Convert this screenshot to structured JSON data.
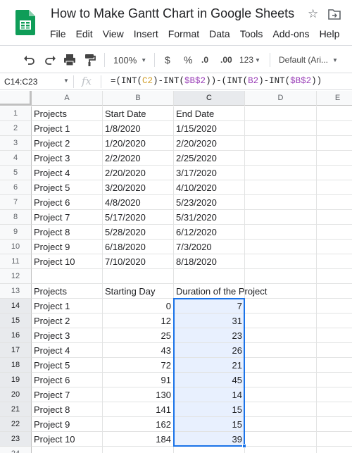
{
  "doc": {
    "title": "How to Make Gantt Chart in Google Sheets",
    "icons": {
      "logo": "google-sheets-logo",
      "star": "star-icon",
      "move": "move-to-folder-icon"
    }
  },
  "menu": [
    "File",
    "Edit",
    "View",
    "Insert",
    "Format",
    "Data",
    "Tools",
    "Add-ons",
    "Help"
  ],
  "toolbar": {
    "zoom": "100%",
    "currency": "$",
    "percent": "%",
    "decrease_decimals": ".0",
    "increase_decimals": ".00",
    "more_formats": "123",
    "font": "Default (Ari...",
    "icons": [
      "undo-icon",
      "redo-icon",
      "print-icon",
      "paint-format-icon"
    ]
  },
  "formula_bar": {
    "name_box": "C14:C23",
    "fx": "fx",
    "formula": {
      "p1": "=(INT(",
      "r1": "C2",
      "p2": ")-INT(",
      "r2": "$B$2",
      "p3": "))-(INT(",
      "r3": "B2",
      "p4": ")-INT(",
      "r4": "$B$2",
      "p5": "))"
    }
  },
  "grid": {
    "columns": [
      "A",
      "B",
      "C",
      "D",
      "E"
    ],
    "rows": [
      {
        "n": "1",
        "a": "Projects",
        "b": "Start Date",
        "c": "End Date"
      },
      {
        "n": "2",
        "a": "Project 1",
        "b": "1/8/2020",
        "c": "1/15/2020"
      },
      {
        "n": "3",
        "a": "Project 2",
        "b": "1/20/2020",
        "c": "2/20/2020"
      },
      {
        "n": "4",
        "a": "Project 3",
        "b": "2/2/2020",
        "c": "2/25/2020"
      },
      {
        "n": "5",
        "a": "Project 4",
        "b": "2/20/2020",
        "c": "3/17/2020"
      },
      {
        "n": "6",
        "a": "Project 5",
        "b": "3/20/2020",
        "c": "4/10/2020"
      },
      {
        "n": "7",
        "a": "Project 6",
        "b": "4/8/2020",
        "c": "5/23/2020"
      },
      {
        "n": "8",
        "a": "Project 7",
        "b": "5/17/2020",
        "c": "5/31/2020"
      },
      {
        "n": "9",
        "a": "Project 8",
        "b": "5/28/2020",
        "c": "6/12/2020"
      },
      {
        "n": "10",
        "a": "Project 9",
        "b": "6/18/2020",
        "c": "7/3/2020"
      },
      {
        "n": "11",
        "a": "Project 10",
        "b": "7/10/2020",
        "c": "8/18/2020"
      },
      {
        "n": "12",
        "a": "",
        "b": "",
        "c": ""
      },
      {
        "n": "13",
        "a": "Projects",
        "b": "Starting Day",
        "c": "Duration of the Project"
      },
      {
        "n": "14",
        "a": "Project 1",
        "b": "0",
        "c": "7"
      },
      {
        "n": "15",
        "a": "Project 2",
        "b": "12",
        "c": "31"
      },
      {
        "n": "16",
        "a": "Project 3",
        "b": "25",
        "c": "23"
      },
      {
        "n": "17",
        "a": "Project 4",
        "b": "43",
        "c": "26"
      },
      {
        "n": "18",
        "a": "Project 5",
        "b": "72",
        "c": "21"
      },
      {
        "n": "19",
        "a": "Project 6",
        "b": "91",
        "c": "45"
      },
      {
        "n": "20",
        "a": "Project 7",
        "b": "130",
        "c": "14"
      },
      {
        "n": "21",
        "a": "Project 8",
        "b": "141",
        "c": "15"
      },
      {
        "n": "22",
        "a": "Project 9",
        "b": "162",
        "c": "15"
      },
      {
        "n": "23",
        "a": "Project 10",
        "b": "184",
        "c": "39"
      },
      {
        "n": "24",
        "a": "",
        "b": "",
        "c": ""
      }
    ],
    "selected_range": "C14:C23",
    "colors": {
      "selection": "#1a73e8",
      "selection_fill": "#e8f0fe"
    }
  }
}
